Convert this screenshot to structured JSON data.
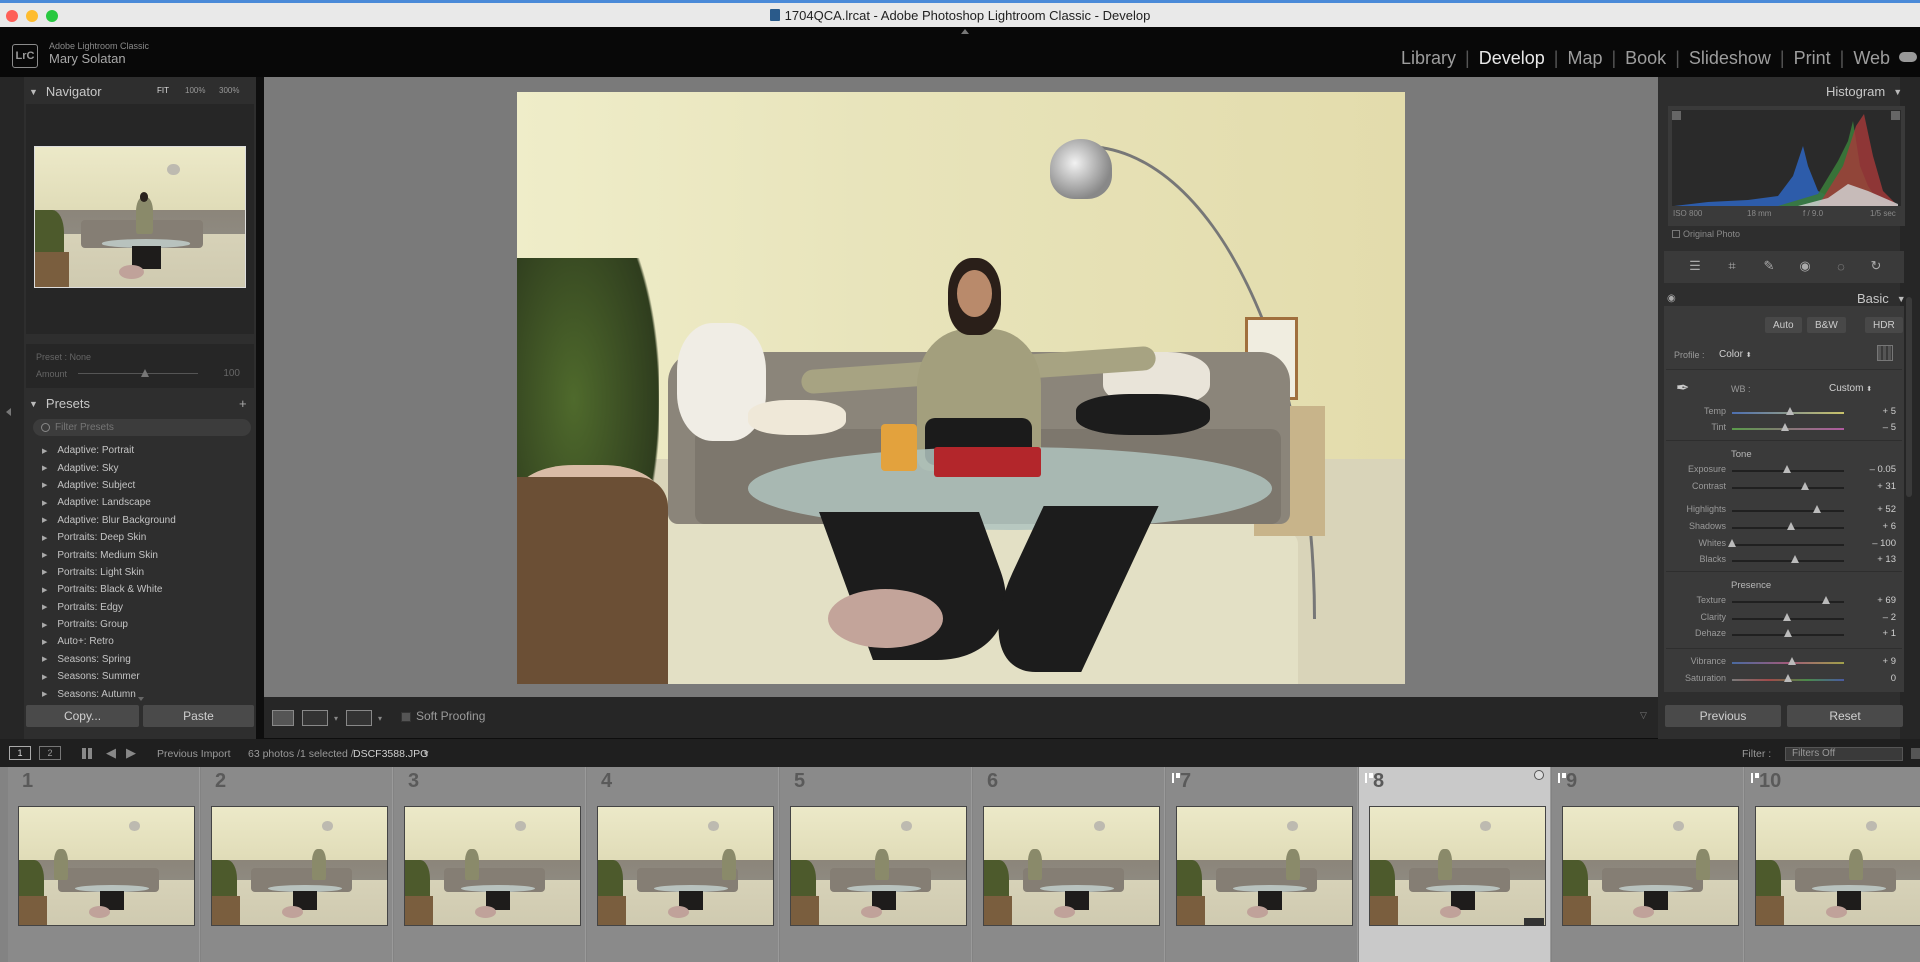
{
  "window": {
    "title": "1704QCA.lrcat - Adobe Photoshop Lightroom Classic - Develop"
  },
  "identity": {
    "logo": "LrC",
    "app_name": "Adobe Lightroom Classic",
    "user": "Mary Solatan"
  },
  "modules": [
    "Library",
    "Develop",
    "Map",
    "Book",
    "Slideshow",
    "Print",
    "Web"
  ],
  "active_module": "Develop",
  "navigator": {
    "title": "Navigator",
    "zoom": [
      "FIT",
      "100%",
      "300%"
    ]
  },
  "preset_amount": {
    "preset": "Preset : None",
    "amount_label": "Amount",
    "amount_value": "100"
  },
  "presets": {
    "title": "Presets",
    "filter_placeholder": "Filter Presets",
    "items": [
      "Adaptive: Portrait",
      "Adaptive: Sky",
      "Adaptive: Subject",
      "Adaptive: Landscape",
      "Adaptive: Blur Background",
      "Portraits: Deep Skin",
      "Portraits: Medium Skin",
      "Portraits: Light Skin",
      "Portraits: Black & White",
      "Portraits: Edgy",
      "Portraits: Group",
      "Auto+: Retro",
      "Seasons: Spring",
      "Seasons: Summer",
      "Seasons: Autumn"
    ]
  },
  "left_buttons": {
    "copy": "Copy...",
    "paste": "Paste"
  },
  "toolbar": {
    "soft_proofing": "Soft Proofing"
  },
  "histogram": {
    "title": "Histogram",
    "iso": "ISO 800",
    "focal": "18 mm",
    "aperture": "f / 9.0",
    "shutter": "1/5 sec",
    "original_photo": "Original Photo"
  },
  "basic": {
    "title": "Basic",
    "treatments": [
      "Auto",
      "B&W",
      "HDR"
    ],
    "profile_label": "Profile :",
    "profile_value": "Color",
    "wb_label": "WB :",
    "wb_value": "Custom",
    "tone_label": "Tone",
    "presence_label": "Presence",
    "sliders": [
      {
        "label": "Temp",
        "value": "+ 5",
        "pos": 0.52
      },
      {
        "label": "Tint",
        "value": "– 5",
        "pos": 0.47
      },
      {
        "label": "Exposure",
        "value": "– 0.05",
        "pos": 0.49
      },
      {
        "label": "Contrast",
        "value": "+ 31",
        "pos": 0.65
      },
      {
        "label": "Highlights",
        "value": "+ 52",
        "pos": 0.76
      },
      {
        "label": "Shadows",
        "value": "+ 6",
        "pos": 0.53
      },
      {
        "label": "Whites",
        "value": "– 100",
        "pos": 0.0
      },
      {
        "label": "Blacks",
        "value": "+ 13",
        "pos": 0.56
      },
      {
        "label": "Texture",
        "value": "+ 69",
        "pos": 0.84
      },
      {
        "label": "Clarity",
        "value": "– 2",
        "pos": 0.49
      },
      {
        "label": "Dehaze",
        "value": "+ 1",
        "pos": 0.5
      },
      {
        "label": "Vibrance",
        "value": "+ 9",
        "pos": 0.54
      },
      {
        "label": "Saturation",
        "value": "0",
        "pos": 0.5
      }
    ]
  },
  "right_buttons": {
    "previous": "Previous",
    "reset": "Reset"
  },
  "filmbar": {
    "screen1": "1",
    "screen2": "2",
    "source": "Previous Import",
    "count": "63 photos /1 selected /",
    "filename": "DSCF3588.JPG",
    "filter_label": "Filter :",
    "filter_value": "Filters Off"
  },
  "filmstrip": [
    {
      "num": "1",
      "flag": false,
      "selected": false
    },
    {
      "num": "2",
      "flag": false,
      "selected": false
    },
    {
      "num": "3",
      "flag": false,
      "selected": false
    },
    {
      "num": "4",
      "flag": false,
      "selected": false
    },
    {
      "num": "5",
      "flag": false,
      "selected": false
    },
    {
      "num": "6",
      "flag": false,
      "selected": false
    },
    {
      "num": "7",
      "flag": true,
      "selected": false
    },
    {
      "num": "8",
      "flag": true,
      "selected": true
    },
    {
      "num": "9",
      "flag": true,
      "selected": false
    },
    {
      "num": "10",
      "flag": true,
      "selected": false
    }
  ]
}
